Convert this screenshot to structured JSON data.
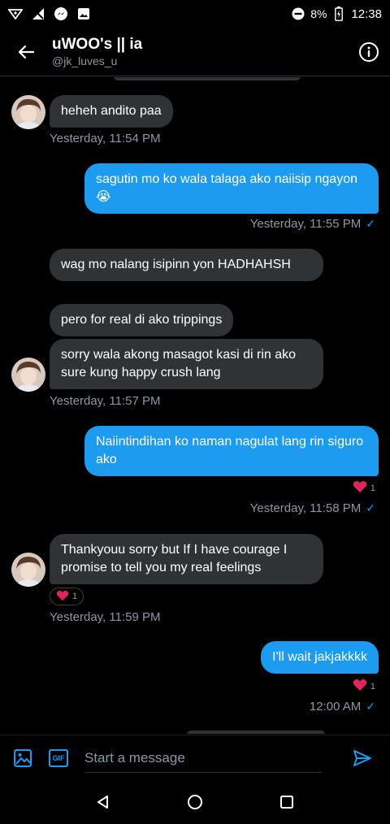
{
  "status_bar": {
    "battery": "8%",
    "time": "12:38"
  },
  "header": {
    "title": "uWOO's || ia",
    "handle": "@jk_luves_u"
  },
  "messages": [
    {
      "side": "in",
      "text": "heheh andito paa",
      "time": "Yesterday, 11:54 PM"
    },
    {
      "side": "out",
      "text": "sagutin mo ko wala talaga ako naiisip ngayon😭",
      "time": "Yesterday, 11:55 PM"
    },
    {
      "side": "in",
      "text": "wag mo nalang isipinn yon HADHAHSH"
    },
    {
      "side": "in",
      "text": "pero for real di ako trippings"
    },
    {
      "side": "in",
      "text": "sorry wala akong masagot kasi di rin ako sure kung happy crush lang",
      "time": "Yesterday, 11:57 PM"
    },
    {
      "side": "out",
      "text": "Naiintindihan ko naman nagulat lang rin siguro ako",
      "reaction_count": "1",
      "time": "Yesterday, 11:58 PM"
    },
    {
      "side": "in",
      "text": "Thankyouu sorry but If I have courage I promise to tell you my real feelings",
      "reaction_count": "1",
      "time": "Yesterday, 11:59 PM"
    },
    {
      "side": "out",
      "text": "I'll wait jakjakkkk",
      "reaction_count": "1",
      "time": "12:00 AM"
    }
  ],
  "composer": {
    "placeholder": "Start a message",
    "gif_label": "GIF"
  },
  "colors": {
    "accent": "#1d9bf0",
    "incoming_bubble": "#2f3336",
    "heart": "#e0245e"
  }
}
